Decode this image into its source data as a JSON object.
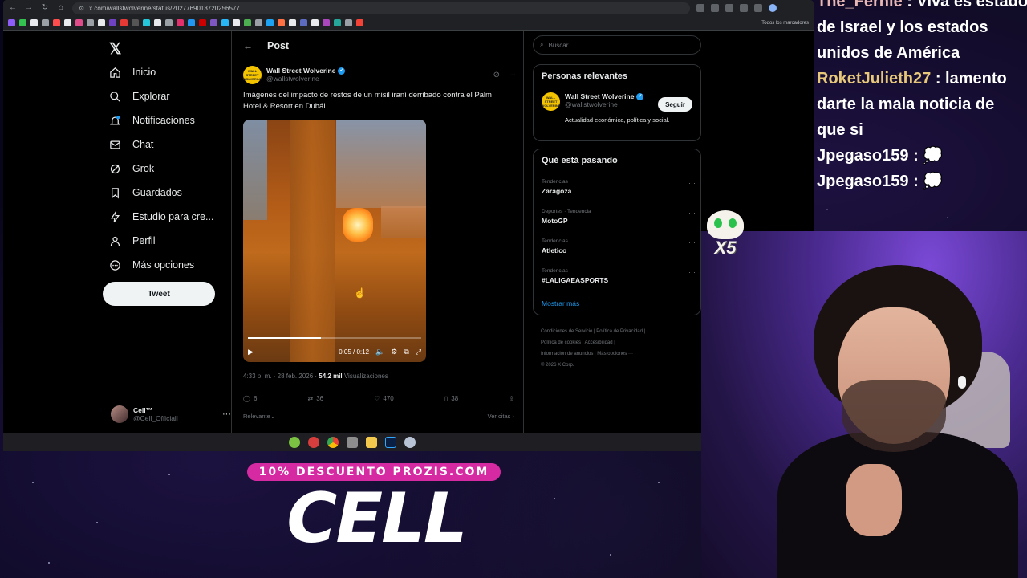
{
  "browser": {
    "url": "x.com/wallstwolverine/status/2027769013720256577",
    "bookmarks_all_label": "Todos los marcadores"
  },
  "sidebar": {
    "logo": "𝕏",
    "items": [
      {
        "label": "Inicio",
        "icon": "home-icon"
      },
      {
        "label": "Explorar",
        "icon": "search-icon"
      },
      {
        "label": "Notificaciones",
        "icon": "bell-icon"
      },
      {
        "label": "Chat",
        "icon": "mail-icon"
      },
      {
        "label": "Grok",
        "icon": "grok-icon"
      },
      {
        "label": "Guardados",
        "icon": "bookmark-icon"
      },
      {
        "label": "Estudio para cre...",
        "icon": "lightning-icon"
      },
      {
        "label": "Perfil",
        "icon": "person-icon"
      },
      {
        "label": "Más opciones",
        "icon": "more-circle-icon"
      }
    ],
    "tweet_button": "Tweet",
    "account": {
      "name": "Cell™",
      "handle": "@Cell_Officiall"
    }
  },
  "post": {
    "header": "Post",
    "author_name": "Wall Street Wolverine",
    "author_handle": "@wallstwolverine",
    "avatar_text": "WALL STREET WOLVERINE",
    "text": "Imágenes del impacto de restos de un misil iraní derribado contra el Palm Hotel & Resort en Dubái.",
    "video": {
      "current": "0:05",
      "duration": "0:12",
      "progress_fraction": 0.42
    },
    "meta_time": "4:33 p. m. · 28 feb. 2026 · ",
    "views_count": "54,2 mil",
    "views_label": " Visualizaciones",
    "stats": {
      "replies": "6",
      "reposts": "36",
      "likes": "470",
      "bookmarks": "38"
    },
    "reply_sort": "Relevante",
    "quotes_link": "Ver citas"
  },
  "right": {
    "search_placeholder": "Buscar",
    "people_title": "Personas relevantes",
    "person_name": "Wall Street Wolverine",
    "person_handle": "@wallstwolverine",
    "follow_label": "Seguir",
    "person_bio": "Actualidad económica, política y social.",
    "trends_title": "Qué está pasando",
    "trends": [
      {
        "category": "Tendencias",
        "name": "Zaragoza"
      },
      {
        "category": "Deportes · Tendencia",
        "name": "MotoGP"
      },
      {
        "category": "Tendencias",
        "name": "Atletico"
      },
      {
        "category": "Tendencias",
        "name": "#LALIGAEASPORTS"
      }
    ],
    "show_more": "Mostrar más",
    "footer": {
      "line1": "Condiciones de Servicio  |  Política de Privacidad  |",
      "line2": "Política de cookies  |  Accesibilidad  |",
      "line3": "Información de anuncios  |  Más opciones ···",
      "line4": "© 2026 X Corp."
    }
  },
  "chat": {
    "line0_user": "The_Fernie",
    "line0_msg": ": Viva es estado",
    "line1": "de Israel y los estados",
    "line2": "unidos de América",
    "line3_user": "RoketJulieth27",
    "line3_msg": ": lamento",
    "line4": "darte la mala noticia de",
    "line5": "que si",
    "line6_user": "Jpegaso159",
    "line6_msg": ":",
    "line7_user": "Jpegaso159",
    "line7_msg": ":"
  },
  "overlay": {
    "multiplier": "X5",
    "promo_badge": "10% DESCUENTO PROZIS.COM",
    "streamer_name": "CELL"
  }
}
